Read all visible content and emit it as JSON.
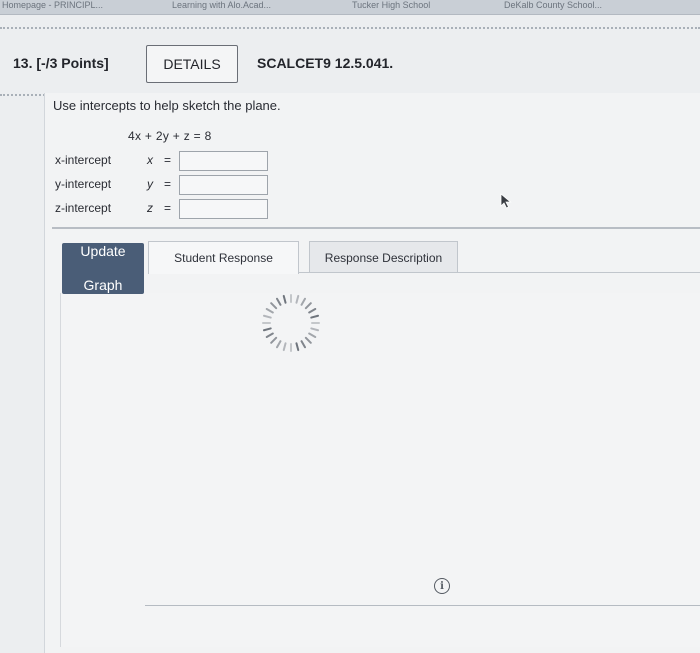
{
  "bookmarks": [
    "Homepage - PRINCIPL...",
    "Learning with Alo.Acad...",
    "Tucker High School",
    "DeKalb County School..."
  ],
  "question": {
    "number": "13.",
    "points": "[-/3 Points]",
    "details_label": "DETAILS",
    "code": "SCALCET9 12.5.041."
  },
  "problem": {
    "instruction": "Use intercepts to help sketch the plane.",
    "equation": "4x + 2y + z = 8"
  },
  "intercepts": [
    {
      "label": "x-intercept",
      "var": "x",
      "eq": "=",
      "value": ""
    },
    {
      "label": "y-intercept",
      "var": "y",
      "eq": "=",
      "value": ""
    },
    {
      "label": "z-intercept",
      "var": "z",
      "eq": "=",
      "value": ""
    }
  ],
  "graph": {
    "update_label": "Update Graph",
    "tabs": [
      "Student Response",
      "Response Description"
    ],
    "active_tab": "Student Response"
  },
  "icons": {
    "spinner": "loading-spinner-icon",
    "info": "info-icon",
    "cursor": "mouse-pointer-icon"
  },
  "colors": {
    "update_button": "#4a5d77",
    "background": "#eceef0"
  }
}
